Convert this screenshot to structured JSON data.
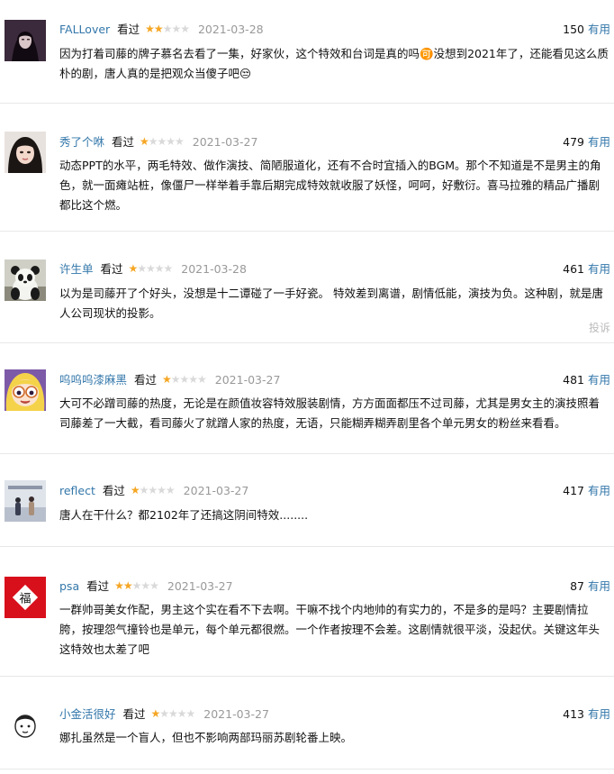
{
  "comments": [
    {
      "user": "FALLover",
      "status": "看过",
      "rating": 2,
      "date": "2021-03-28",
      "votes": "150",
      "vote_label": "有用",
      "text": "因为打着司藤的牌子慕名去看了一集，好家伙，这个特效和台词是真的吗🉑没想到2021年了，还能看见这么质朴的剧，唐人真的是把观众当傻子吧😒",
      "avatar": "dark-portrait-avatar"
    },
    {
      "user": "秀了个咻",
      "status": "看过",
      "rating": 1,
      "date": "2021-03-27",
      "votes": "479",
      "vote_label": "有用",
      "text": "动态PPT的水平，两毛特效、做作演技、简陋服道化，还有不合时宜插入的BGM。那个不知道是不是男主的角色，就一面瘫站桩，像僵尸一样举着手靠后期完成特效就收服了妖怪，呵呵，好敷衍。喜马拉雅的精品广播剧都比这个燃。",
      "avatar": "woman-portrait-avatar"
    },
    {
      "user": "许生单",
      "status": "看过",
      "rating": 1,
      "date": "2021-03-28",
      "votes": "461",
      "vote_label": "有用",
      "text": "以为是司藤开了个好头，没想是十二谭碰了一手好瓷。 特效差到离谱，剧情低能，演技为负。这种剧，就是唐人公司现状的投影。",
      "report": "投诉",
      "avatar": "panda-avatar"
    },
    {
      "user": "呜呜呜漆麻黑",
      "status": "看过",
      "rating": 1,
      "date": "2021-03-27",
      "votes": "481",
      "vote_label": "有用",
      "text": "大可不必蹭司藤的热度，无论是在颜值妆容特效服装剧情，方方面面都压不过司藤，尤其是男女主的演技照着司藤差了一大截，看司藤火了就蹭人家的热度，无语，只能糊弄糊弄剧里各个单元男女的粉丝来看看。",
      "avatar": "cartoon-girl-avatar"
    },
    {
      "user": "reflect",
      "status": "看过",
      "rating": 1,
      "date": "2021-03-27",
      "votes": "417",
      "vote_label": "有用",
      "text": "唐人在干什么？都2102年了还搞这阴间特效........",
      "avatar": "couple-photo-avatar"
    },
    {
      "user": "psa",
      "status": "看过",
      "rating": 2,
      "date": "2021-03-27",
      "votes": "87",
      "vote_label": "有用",
      "text": "一群帅哥美女作配，男主这个实在看不下去啊。干嘛不找个内地帅的有实力的，不是多的是吗？主要剧情拉胯，按理怨气撞铃也是单元，每个单元都很燃。一个作者按理不会差。这剧情就很平淡，没起伏。关键这年头这特效也太差了吧",
      "avatar": "fu-character-avatar",
      "avatar_char": "福"
    },
    {
      "user": "小金活很好",
      "status": "看过",
      "rating": 1,
      "date": "2021-03-27",
      "votes": "413",
      "vote_label": "有用",
      "text": "娜扎虽然是一个盲人，但也不影响两部玛丽苏剧轮番上映。",
      "avatar": "cartoon-face-avatar"
    }
  ],
  "colors": {
    "accent": "#3377aa",
    "star": "#f5a623",
    "muted": "#999999"
  }
}
